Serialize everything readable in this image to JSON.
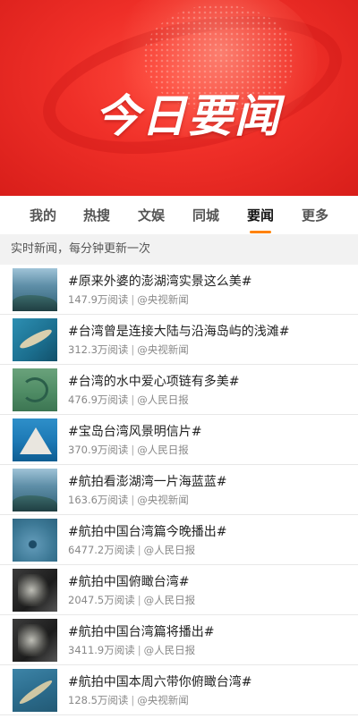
{
  "banner": {
    "title": "今日要闻"
  },
  "tabs": [
    {
      "label": "我的",
      "active": false
    },
    {
      "label": "热搜",
      "active": false
    },
    {
      "label": "文娱",
      "active": false
    },
    {
      "label": "同城",
      "active": false
    },
    {
      "label": "要闻",
      "active": true
    },
    {
      "label": "更多",
      "active": false
    }
  ],
  "notice": "实时新闻，每分钟更新一次",
  "items": [
    {
      "topic": "#原来外婆的澎湖湾实景这么美#",
      "reads": "147.9万阅读",
      "source": "@央视新闻",
      "thumb": "sea-aerial-icon"
    },
    {
      "topic": "#台湾曾是连接大陆与沿海岛屿的浅滩#",
      "reads": "312.3万阅读",
      "source": "@央视新闻",
      "thumb": "island-sandbar-icon"
    },
    {
      "topic": "#台湾的水中爱心项链有多美#",
      "reads": "476.9万阅读",
      "source": "@人民日报",
      "thumb": "green-islet-icon"
    },
    {
      "topic": "#宝岛台湾风景明信片#",
      "reads": "370.9万阅读",
      "source": "@人民日报",
      "thumb": "mountain-island-icon"
    },
    {
      "topic": "#航拍看澎湖湾一片海蓝蓝#",
      "reads": "163.6万阅读",
      "source": "@央视新闻",
      "thumb": "sea-aerial-icon"
    },
    {
      "topic": "#航拍中国台湾篇今晚播出#",
      "reads": "6477.2万阅读",
      "source": "@人民日报",
      "thumb": "blue-sea-icon"
    },
    {
      "topic": "#航拍中国俯瞰台湾#",
      "reads": "2047.5万阅读",
      "source": "@人民日报",
      "thumb": "documentary-poster-icon"
    },
    {
      "topic": "#航拍中国台湾篇将播出#",
      "reads": "3411.9万阅读",
      "source": "@人民日报",
      "thumb": "documentary-poster-icon"
    },
    {
      "topic": "#航拍中国本周六带你俯瞰台湾#",
      "reads": "128.5万阅读",
      "source": "@央视新闻",
      "thumb": "coastline-icon"
    }
  ],
  "colors": {
    "brand_red": "#ef2f28",
    "tab_indicator": "#ff8200",
    "notice_bg": "#f2f2f2"
  }
}
